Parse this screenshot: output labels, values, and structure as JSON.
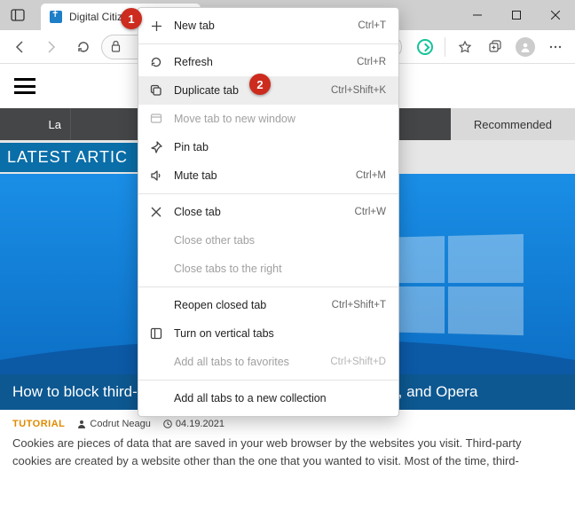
{
  "window": {
    "minimize": "—",
    "maximize": "▢",
    "close": "✕"
  },
  "tab": {
    "title": "Digital Citizen - digital w...",
    "close": "✕"
  },
  "contextMenu": {
    "items": [
      {
        "icon": "plus",
        "label": "New tab",
        "shortcut": "Ctrl+T",
        "disabled": false
      },
      {
        "sep": true
      },
      {
        "icon": "refresh",
        "label": "Refresh",
        "shortcut": "Ctrl+R",
        "disabled": false
      },
      {
        "icon": "dup",
        "label": "Duplicate tab",
        "shortcut": "Ctrl+Shift+K",
        "disabled": false,
        "hover": true
      },
      {
        "icon": "window",
        "label": "Move tab to new window",
        "shortcut": "",
        "disabled": true
      },
      {
        "icon": "pin",
        "label": "Pin tab",
        "shortcut": "",
        "disabled": false
      },
      {
        "icon": "mute",
        "label": "Mute tab",
        "shortcut": "Ctrl+M",
        "disabled": false
      },
      {
        "sep": true
      },
      {
        "icon": "close",
        "label": "Close tab",
        "shortcut": "Ctrl+W",
        "disabled": false
      },
      {
        "icon": "",
        "label": "Close other tabs",
        "shortcut": "",
        "disabled": true
      },
      {
        "icon": "",
        "label": "Close tabs to the right",
        "shortcut": "",
        "disabled": true
      },
      {
        "sep": true
      },
      {
        "icon": "",
        "label": "Reopen closed tab",
        "shortcut": "Ctrl+Shift+T",
        "disabled": false
      },
      {
        "icon": "vtabs",
        "label": "Turn on vertical tabs",
        "shortcut": "",
        "disabled": false
      },
      {
        "icon": "",
        "label": "Add all tabs to favorites",
        "shortcut": "Ctrl+Shift+D",
        "disabled": true
      },
      {
        "sep": true
      },
      {
        "icon": "",
        "label": "Add all tabs to a new collection",
        "shortcut": "",
        "disabled": false
      }
    ]
  },
  "page": {
    "navTabLeft": "La",
    "navRecommended": "Recommended",
    "sectionTitle": "LATEST ARTIC",
    "articleTitle": "How to block third-party cookies in Chrome, Firefox, Edge, and Opera",
    "category": "TUTORIAL",
    "author": "Codrut Neagu",
    "date": "04.19.2021",
    "body": "Cookies are pieces of data that are saved in your web browser by the websites you visit. Third-party cookies are created by a website other than the one that you wanted to visit. Most of the time, third-"
  },
  "annotations": {
    "badge1": "1",
    "badge2": "2"
  }
}
